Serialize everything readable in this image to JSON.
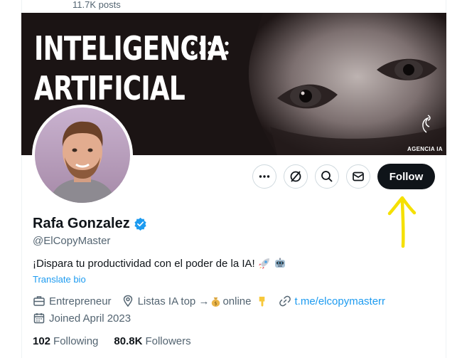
{
  "header": {
    "posts_count": "11.7K posts"
  },
  "banner": {
    "title_line1": "INTELIGENCIA",
    "title_line2": "ARTIFICIAL",
    "logo_text": "AGENCIA IA"
  },
  "profile": {
    "display_name": "Rafa Gonzalez",
    "handle": "@ElCopyMaster",
    "bio": "¡Dispara tu productividad con el poder de la IA!",
    "bio_emojis": [
      "rocket-emoji",
      "robot-emoji"
    ],
    "translate_label": "Translate bio",
    "occupation": "Entrepreneur",
    "location_prefix": "Listas IA top →",
    "location_suffix": "online",
    "location_emojis": [
      "money-bag-emoji",
      "pointing-down-emoji"
    ],
    "website": "t.me/elcopymasterr",
    "joined": "Joined April 2023",
    "following_count": "102",
    "following_label": "Following",
    "followers_count": "80.8K",
    "followers_label": "Followers"
  },
  "actions": {
    "more_icon": "more-icon",
    "grok_icon": "grok-icon",
    "search_icon": "search-icon",
    "message_icon": "mail-icon",
    "follow_label": "Follow"
  },
  "colors": {
    "accent": "#1d9bf0",
    "follow_bg": "#0f1419",
    "annotation_arrow": "#f5e000",
    "secondary_text": "#536471"
  }
}
